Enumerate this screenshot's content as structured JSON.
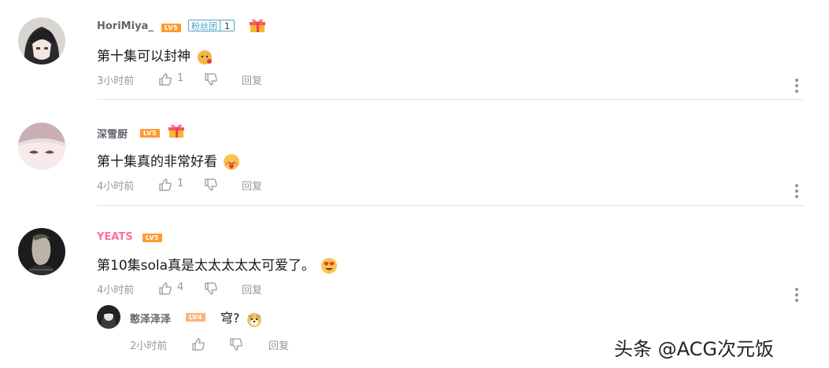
{
  "comments": [
    {
      "username": "HoriMiya_",
      "level": "LV5",
      "fan_badge": {
        "label": "粉丝团",
        "num": "1"
      },
      "text": "第十集可以封神",
      "emoji": "doge-rose-emoji",
      "time": "3小时前",
      "likes": "1",
      "reply_label": "回复"
    },
    {
      "username": "深雪厨",
      "level": "LV5",
      "text": "第十集真的非常好看",
      "emoji": "heart-blush-emoji",
      "time": "4小时前",
      "likes": "1",
      "reply_label": "回复"
    },
    {
      "username": "YEATS",
      "level": "LV5",
      "text": "第10集sola真是太太太太太可爱了。",
      "emoji": "heart-eyes-emoji",
      "time": "4小时前",
      "likes": "4",
      "reply_label": "回复",
      "reply": {
        "username": "憨泽泽泽",
        "level": "LV4",
        "text": "穹?",
        "emoji": "doge-emoji",
        "time": "2小时前",
        "reply_label": "回复"
      }
    }
  ],
  "watermark": "头条 @ACG次元饭",
  "colors": {
    "accent_pink": "#fb7299",
    "level_orange": "#ff9b2e",
    "meta_gray": "#9499a0"
  }
}
